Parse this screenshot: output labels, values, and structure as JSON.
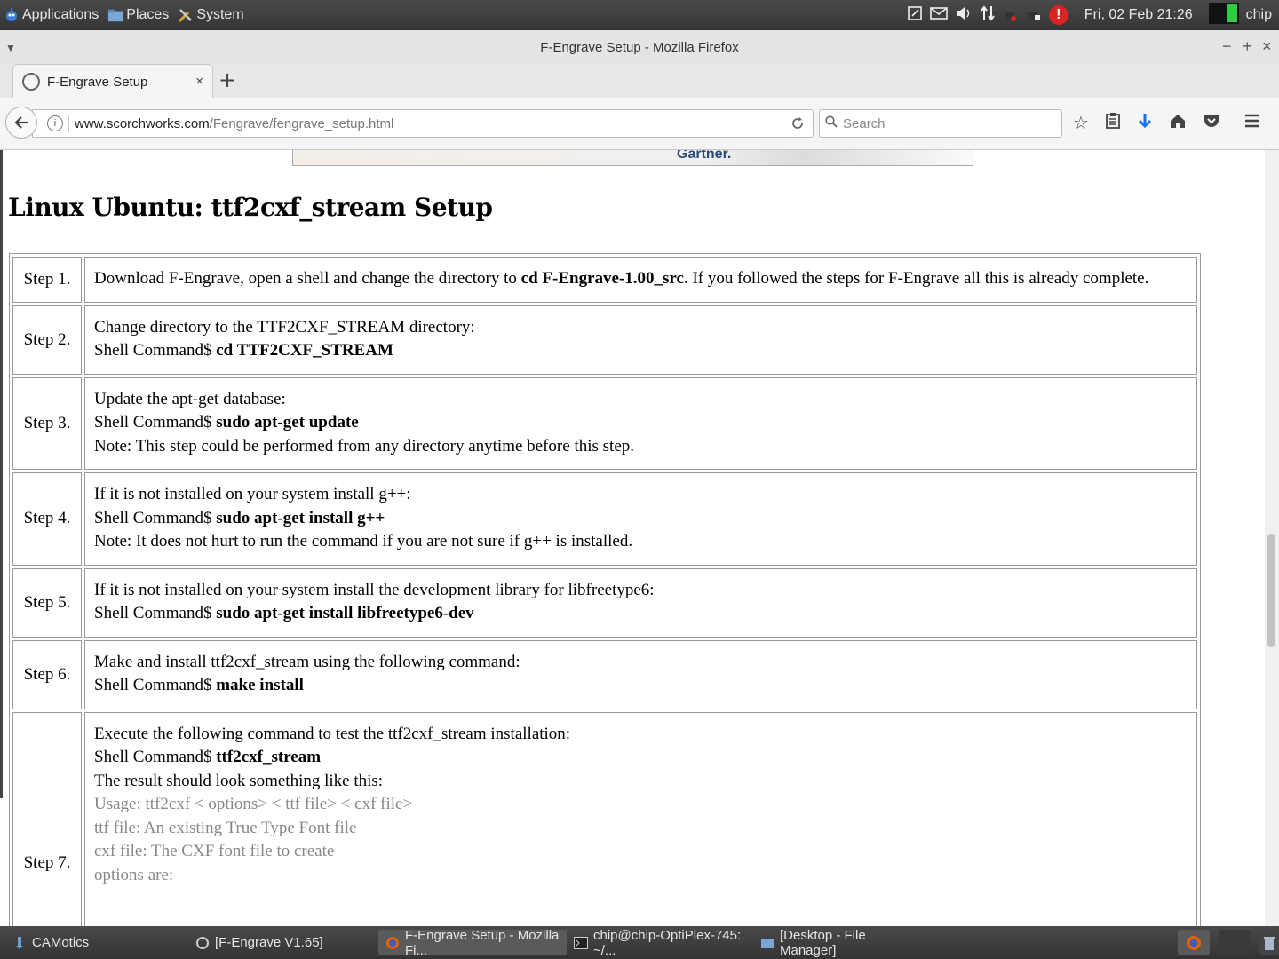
{
  "top_panel": {
    "applications": "Applications",
    "places": "Places",
    "system": "System",
    "clock": "Fri, 02 Feb  21:26",
    "user": "chip"
  },
  "window": {
    "title": "F-Engrave Setup - Mozilla Firefox",
    "minimize": "−",
    "maximize": "+",
    "close": "×"
  },
  "tabs": [
    {
      "label": "F-Engrave Setup",
      "close": "×"
    }
  ],
  "new_tab": "+",
  "url": {
    "host": "www.scorchworks.com",
    "path": "/Fengrave/fengrave_setup.html"
  },
  "search": {
    "placeholder": "Search"
  },
  "ad": {
    "brand": "Gartner."
  },
  "page": {
    "heading": "Linux Ubuntu: ttf2cxf_stream Setup",
    "steps": [
      {
        "label": "Step 1.",
        "text_a": "Download F-Engrave, open a shell and change the directory to ",
        "cmd": "cd F-Engrave-1.00_src",
        "text_b": ". If you followed the steps for F-Engrave all this is already complete."
      },
      {
        "label": "Step 2.",
        "line1": "Change directory to the TTF2CXF_STREAM directory:",
        "prefix": "Shell Command$ ",
        "cmd": "cd TTF2CXF_STREAM"
      },
      {
        "label": "Step 3.",
        "line1": "Update the apt-get database:",
        "prefix": "Shell Command$ ",
        "cmd": "sudo apt-get update",
        "note": "Note: This step could be performed from any directory anytime before this step."
      },
      {
        "label": "Step 4.",
        "line1": "If it is not installed on your system install g++:",
        "prefix": "Shell Command$ ",
        "cmd": "sudo apt-get install g++",
        "note": "Note: It does not hurt to run the command if you are not sure if g++ is installed."
      },
      {
        "label": "Step 5.",
        "line1": "If it is not installed on your system install the development library for libfreetype6:",
        "prefix": "Shell Command$ ",
        "cmd": "sudo apt-get install libfreetype6-dev"
      },
      {
        "label": "Step 6.",
        "line1": "Make and install ttf2cxf_stream using the following command:",
        "prefix": "Shell Command$ ",
        "cmd": "make install"
      },
      {
        "label": "Step 7.",
        "line1": "Execute the following command to test the ttf2cxf_stream installation:",
        "prefix": "Shell Command$ ",
        "cmd": "ttf2cxf_stream",
        "line3": "The result should look something like this:",
        "out1": "Usage: ttf2cxf < options> < ttf file> < cxf file>",
        "out2": "ttf file: An existing True Type Font file",
        "out3": "cxf file: The CXF font file to create",
        "out4": "options are:"
      }
    ]
  },
  "taskbar": [
    {
      "label": "CAMotics"
    },
    {
      "label": "[F-Engrave V1.65]"
    },
    {
      "label": "F-Engrave Setup - Mozilla Fi..."
    },
    {
      "label": "chip@chip-OptiPlex-745: ~/..."
    },
    {
      "label": "[Desktop - File Manager]"
    }
  ],
  "colors": {
    "accent": "#1a73e8",
    "alert": "#dd2222"
  }
}
